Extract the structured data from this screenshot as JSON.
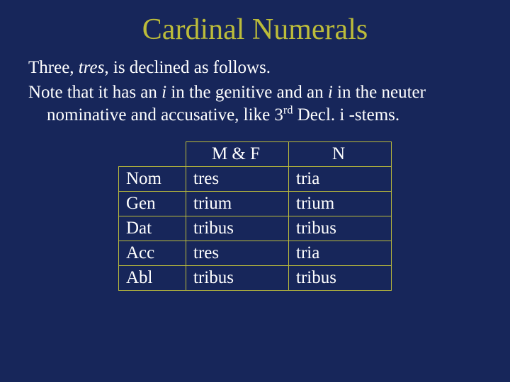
{
  "title": "Cardinal Numerals",
  "paragraph1": {
    "pre": "Three, ",
    "italic": "tres",
    "post": ", is declined as follows."
  },
  "paragraph2": {
    "t1": "Note that it has an ",
    "i1": "i",
    "t2": " in the genitive and an ",
    "i2": "i",
    "t3": " in the neuter nominative and accusative, like 3",
    "sup": "rd",
    "t4": " Decl. i -stems."
  },
  "table": {
    "headers": {
      "mf": "M & F",
      "n": "N"
    },
    "rows": [
      {
        "case": "Nom",
        "mf": "tres",
        "n": "tria"
      },
      {
        "case": "Gen",
        "mf": "trium",
        "n": "trium"
      },
      {
        "case": "Dat",
        "mf": "tribus",
        "n": "tribus"
      },
      {
        "case": "Acc",
        "mf": "tres",
        "n": "tria"
      },
      {
        "case": "Abl",
        "mf": "tribus",
        "n": "tribus"
      }
    ]
  }
}
